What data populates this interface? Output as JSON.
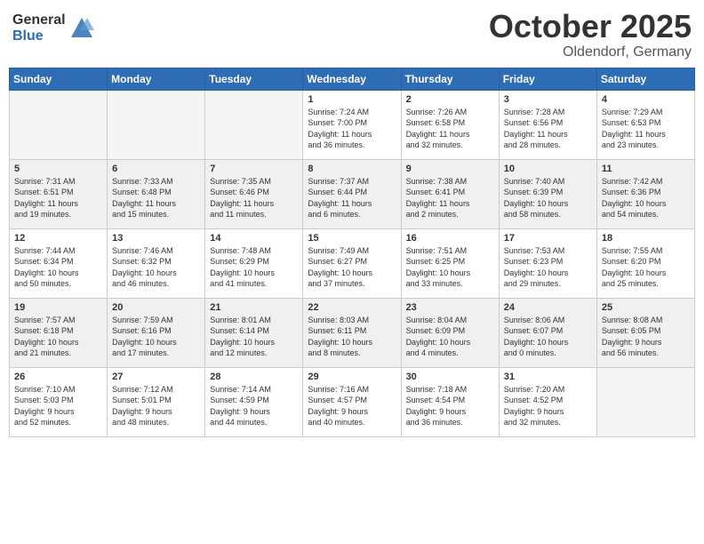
{
  "header": {
    "logo_general": "General",
    "logo_blue": "Blue",
    "month": "October 2025",
    "location": "Oldendorf, Germany"
  },
  "days_of_week": [
    "Sunday",
    "Monday",
    "Tuesday",
    "Wednesday",
    "Thursday",
    "Friday",
    "Saturday"
  ],
  "weeks": [
    [
      {
        "day": "",
        "info": ""
      },
      {
        "day": "",
        "info": ""
      },
      {
        "day": "",
        "info": ""
      },
      {
        "day": "1",
        "info": "Sunrise: 7:24 AM\nSunset: 7:00 PM\nDaylight: 11 hours\nand 36 minutes."
      },
      {
        "day": "2",
        "info": "Sunrise: 7:26 AM\nSunset: 6:58 PM\nDaylight: 11 hours\nand 32 minutes."
      },
      {
        "day": "3",
        "info": "Sunrise: 7:28 AM\nSunset: 6:56 PM\nDaylight: 11 hours\nand 28 minutes."
      },
      {
        "day": "4",
        "info": "Sunrise: 7:29 AM\nSunset: 6:53 PM\nDaylight: 11 hours\nand 23 minutes."
      }
    ],
    [
      {
        "day": "5",
        "info": "Sunrise: 7:31 AM\nSunset: 6:51 PM\nDaylight: 11 hours\nand 19 minutes."
      },
      {
        "day": "6",
        "info": "Sunrise: 7:33 AM\nSunset: 6:48 PM\nDaylight: 11 hours\nand 15 minutes."
      },
      {
        "day": "7",
        "info": "Sunrise: 7:35 AM\nSunset: 6:46 PM\nDaylight: 11 hours\nand 11 minutes."
      },
      {
        "day": "8",
        "info": "Sunrise: 7:37 AM\nSunset: 6:44 PM\nDaylight: 11 hours\nand 6 minutes."
      },
      {
        "day": "9",
        "info": "Sunrise: 7:38 AM\nSunset: 6:41 PM\nDaylight: 11 hours\nand 2 minutes."
      },
      {
        "day": "10",
        "info": "Sunrise: 7:40 AM\nSunset: 6:39 PM\nDaylight: 10 hours\nand 58 minutes."
      },
      {
        "day": "11",
        "info": "Sunrise: 7:42 AM\nSunset: 6:36 PM\nDaylight: 10 hours\nand 54 minutes."
      }
    ],
    [
      {
        "day": "12",
        "info": "Sunrise: 7:44 AM\nSunset: 6:34 PM\nDaylight: 10 hours\nand 50 minutes."
      },
      {
        "day": "13",
        "info": "Sunrise: 7:46 AM\nSunset: 6:32 PM\nDaylight: 10 hours\nand 46 minutes."
      },
      {
        "day": "14",
        "info": "Sunrise: 7:48 AM\nSunset: 6:29 PM\nDaylight: 10 hours\nand 41 minutes."
      },
      {
        "day": "15",
        "info": "Sunrise: 7:49 AM\nSunset: 6:27 PM\nDaylight: 10 hours\nand 37 minutes."
      },
      {
        "day": "16",
        "info": "Sunrise: 7:51 AM\nSunset: 6:25 PM\nDaylight: 10 hours\nand 33 minutes."
      },
      {
        "day": "17",
        "info": "Sunrise: 7:53 AM\nSunset: 6:23 PM\nDaylight: 10 hours\nand 29 minutes."
      },
      {
        "day": "18",
        "info": "Sunrise: 7:55 AM\nSunset: 6:20 PM\nDaylight: 10 hours\nand 25 minutes."
      }
    ],
    [
      {
        "day": "19",
        "info": "Sunrise: 7:57 AM\nSunset: 6:18 PM\nDaylight: 10 hours\nand 21 minutes."
      },
      {
        "day": "20",
        "info": "Sunrise: 7:59 AM\nSunset: 6:16 PM\nDaylight: 10 hours\nand 17 minutes."
      },
      {
        "day": "21",
        "info": "Sunrise: 8:01 AM\nSunset: 6:14 PM\nDaylight: 10 hours\nand 12 minutes."
      },
      {
        "day": "22",
        "info": "Sunrise: 8:03 AM\nSunset: 6:11 PM\nDaylight: 10 hours\nand 8 minutes."
      },
      {
        "day": "23",
        "info": "Sunrise: 8:04 AM\nSunset: 6:09 PM\nDaylight: 10 hours\nand 4 minutes."
      },
      {
        "day": "24",
        "info": "Sunrise: 8:06 AM\nSunset: 6:07 PM\nDaylight: 10 hours\nand 0 minutes."
      },
      {
        "day": "25",
        "info": "Sunrise: 8:08 AM\nSunset: 6:05 PM\nDaylight: 9 hours\nand 56 minutes."
      }
    ],
    [
      {
        "day": "26",
        "info": "Sunrise: 7:10 AM\nSunset: 5:03 PM\nDaylight: 9 hours\nand 52 minutes."
      },
      {
        "day": "27",
        "info": "Sunrise: 7:12 AM\nSunset: 5:01 PM\nDaylight: 9 hours\nand 48 minutes."
      },
      {
        "day": "28",
        "info": "Sunrise: 7:14 AM\nSunset: 4:59 PM\nDaylight: 9 hours\nand 44 minutes."
      },
      {
        "day": "29",
        "info": "Sunrise: 7:16 AM\nSunset: 4:57 PM\nDaylight: 9 hours\nand 40 minutes."
      },
      {
        "day": "30",
        "info": "Sunrise: 7:18 AM\nSunset: 4:54 PM\nDaylight: 9 hours\nand 36 minutes."
      },
      {
        "day": "31",
        "info": "Sunrise: 7:20 AM\nSunset: 4:52 PM\nDaylight: 9 hours\nand 32 minutes."
      },
      {
        "day": "",
        "info": ""
      }
    ]
  ]
}
